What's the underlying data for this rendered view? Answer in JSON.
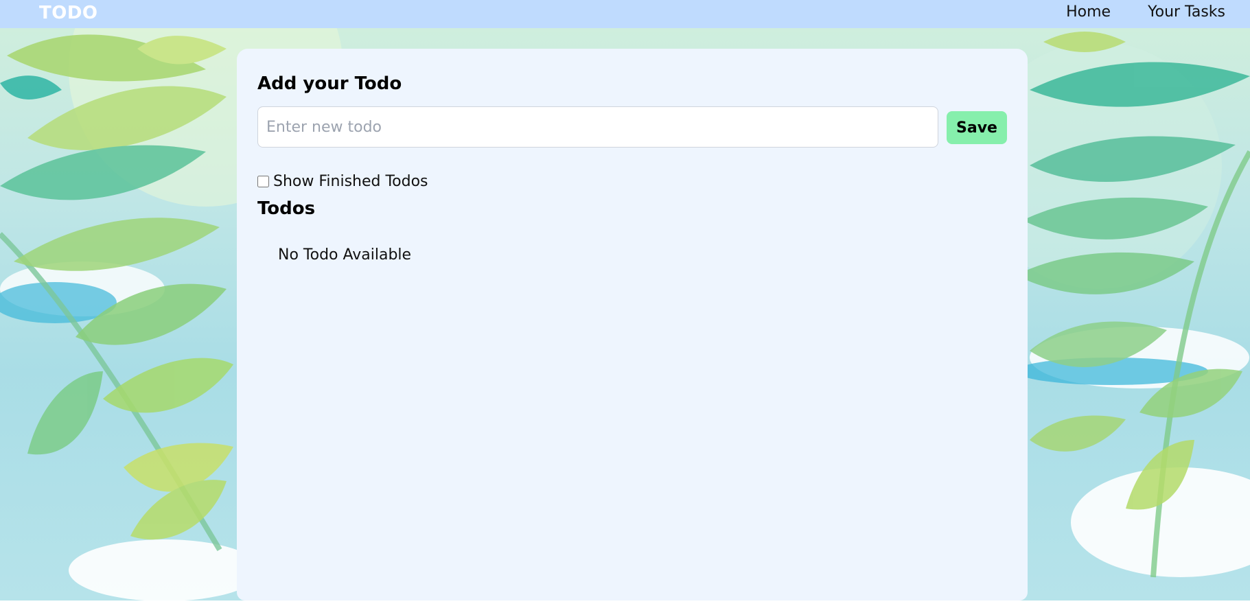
{
  "navbar": {
    "brand": "TODO",
    "links": [
      "Home",
      "Your Tasks"
    ]
  },
  "card": {
    "title": "Add your Todo",
    "input_placeholder": "Enter new todo",
    "input_value": "",
    "save_label": "Save",
    "show_finished_label": "Show Finished Todos",
    "show_finished_checked": false,
    "todos_heading": "Todos",
    "empty_message": "No Todo Available"
  },
  "colors": {
    "navbar": "#bfdbfe",
    "card": "#eef5fe",
    "save_button": "#86efac"
  }
}
